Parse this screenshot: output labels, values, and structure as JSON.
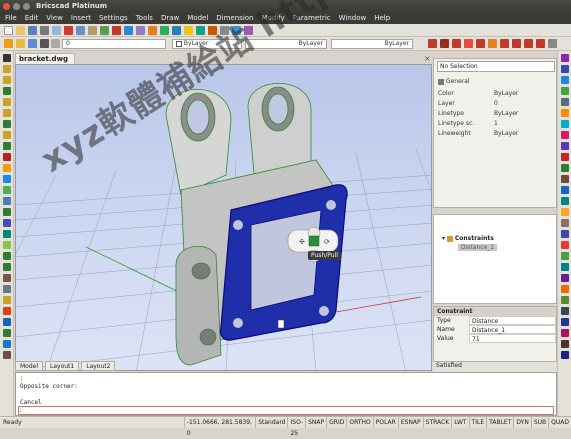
{
  "window": {
    "title": "Bricscad Platinum"
  },
  "menu": [
    "File",
    "Edit",
    "View",
    "Insert",
    "Settings",
    "Tools",
    "Draw",
    "Model",
    "Dimension",
    "Modify",
    "Parametric",
    "Window",
    "Help"
  ],
  "toolbar": {
    "layer_value": "0",
    "color_value": "ByLayer",
    "linetype_value": "ByLayer",
    "lineweight_value": "ByLayer"
  },
  "document": {
    "tab_label": "bracket.dwg"
  },
  "viewport": {
    "tooltip": "Push/Pull",
    "layout_tabs": [
      "Model",
      "Layout1",
      "Layout2"
    ]
  },
  "properties": {
    "selection": "No Selection",
    "section": "General",
    "rows": [
      {
        "label": "Color",
        "value": "ByLayer"
      },
      {
        "label": "Layer",
        "value": "0"
      },
      {
        "label": "Linetype",
        "value": "ByLayer"
      },
      {
        "label": "Linetype sc.",
        "value": "1"
      },
      {
        "label": "Lineweight",
        "value": "ByLayer"
      }
    ]
  },
  "mechanical_browser": {
    "root": "Constraints",
    "child": "Distance_1"
  },
  "constraint_panel": {
    "header": "Constraint",
    "rows": [
      {
        "label": "Type",
        "value": "Distance"
      },
      {
        "label": "Name",
        "value": "Distance_1"
      },
      {
        "label": "Value",
        "value": "71"
      }
    ],
    "status": "Satisfied"
  },
  "command_line": {
    "lines": [
      ":",
      "Opposite corner:",
      "",
      "Cancel"
    ],
    "prompt": ":"
  },
  "statusbar": {
    "ready": "Ready",
    "coords": "-151.0666, 281.5839, 0",
    "segments": [
      "Standard",
      "ISO-25",
      "SNAP",
      "GRID",
      "ORTHO",
      "POLAR",
      "ESNAP",
      "STRACK",
      "LWT",
      "TILE",
      "TABLET",
      "DYN",
      "SUB",
      "QUAD"
    ]
  },
  "watermark": {
    "text": "xyz軟體補給站 http://31.to"
  },
  "colors": {
    "menubar": "#3c3b37",
    "highlight_blue": "#1a1aa0",
    "viewport_top": "#b8c6e8"
  }
}
